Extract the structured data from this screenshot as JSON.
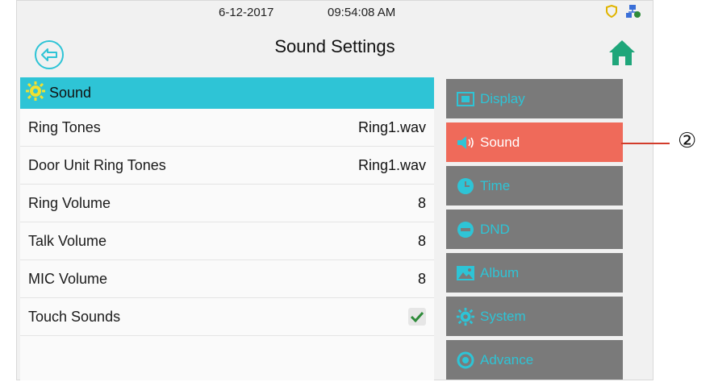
{
  "status": {
    "date": "6-12-2017",
    "time": "09:54:08 AM",
    "icons": [
      "shield-icon",
      "network-icon"
    ]
  },
  "header": {
    "title": "Sound Settings"
  },
  "section": {
    "label": "Sound",
    "icon": "gear-icon"
  },
  "settings": [
    {
      "label": "Ring Tones",
      "value": "Ring1.wav"
    },
    {
      "label": "Door Unit Ring Tones",
      "value": "Ring1.wav"
    },
    {
      "label": "Ring Volume",
      "value": "8"
    },
    {
      "label": "Talk Volume",
      "value": "8"
    },
    {
      "label": "MIC Volume",
      "value": "8"
    },
    {
      "label": "Touch Sounds",
      "checked": true
    }
  ],
  "menu": [
    {
      "label": "Display",
      "icon": "display-icon",
      "active": false
    },
    {
      "label": "Sound",
      "icon": "speaker-icon",
      "active": true
    },
    {
      "label": "Time",
      "icon": "clock-icon",
      "active": false
    },
    {
      "label": "DND",
      "icon": "dnd-icon",
      "active": false
    },
    {
      "label": "Album",
      "icon": "album-icon",
      "active": false
    },
    {
      "label": "System",
      "icon": "gear-icon",
      "active": false
    },
    {
      "label": "Advance",
      "icon": "advance-icon",
      "active": false
    }
  ],
  "callout": {
    "number": "②"
  },
  "colors": {
    "accent": "#2ec4d6",
    "active_menu": "#ef6a5a",
    "menu_bg": "#7a7a7a",
    "check": "#2e8b3a"
  }
}
